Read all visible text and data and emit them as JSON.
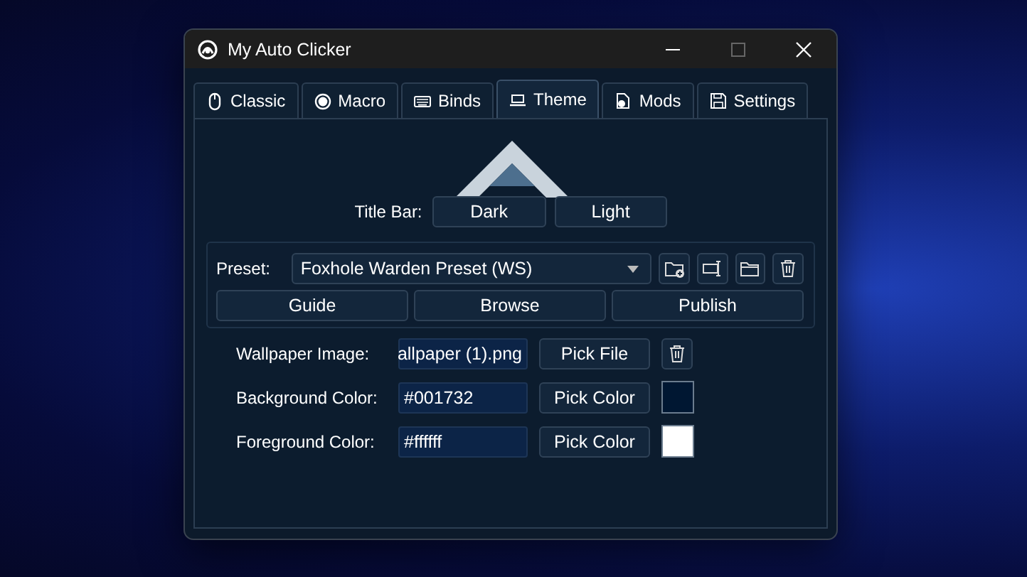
{
  "window": {
    "title": "My Auto Clicker"
  },
  "tabs": [
    {
      "label": "Classic",
      "selected": false
    },
    {
      "label": "Macro",
      "selected": false
    },
    {
      "label": "Binds",
      "selected": false
    },
    {
      "label": "Theme",
      "selected": true
    },
    {
      "label": "Mods",
      "selected": false
    },
    {
      "label": "Settings",
      "selected": false
    }
  ],
  "title_bar": {
    "label": "Title Bar:",
    "options": [
      "Dark",
      "Light"
    ]
  },
  "preset": {
    "label": "Preset:",
    "value": "Foxhole Warden Preset (WS)",
    "actions": [
      "Guide",
      "Browse",
      "Publish"
    ]
  },
  "fields": [
    {
      "kind": "file",
      "label": "Wallpaper Image:",
      "value": "allpaper (1).png",
      "button": "Pick File"
    },
    {
      "kind": "color",
      "label": "Background Color:",
      "value": "#001732",
      "button": "Pick Color",
      "color": "#001732"
    },
    {
      "kind": "color",
      "label": "Foreground Color:",
      "value": "#ffffff",
      "button": "Pick Color",
      "color": "#ffffff"
    }
  ]
}
